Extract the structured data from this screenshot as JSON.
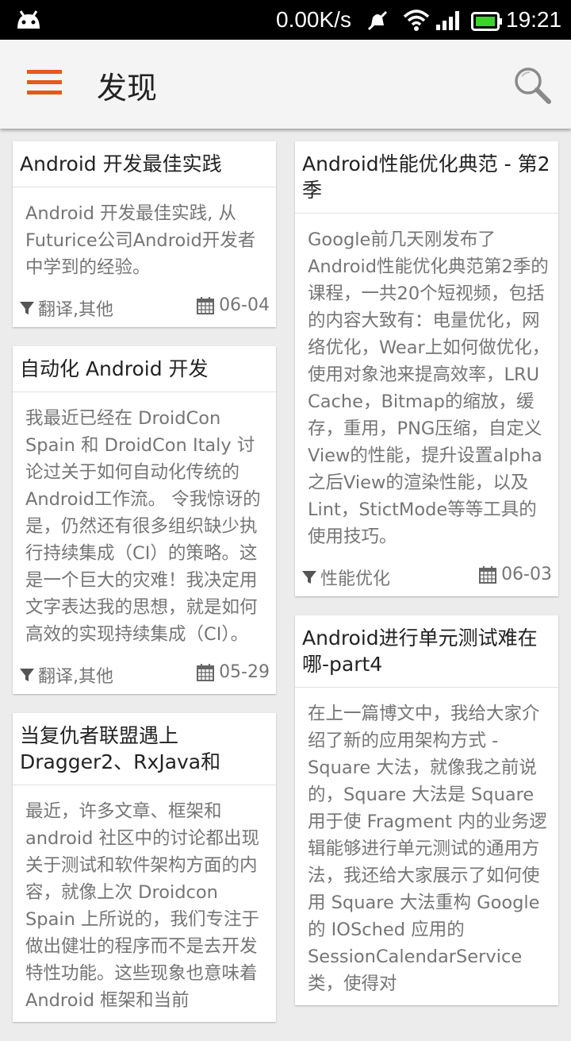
{
  "status_bar": {
    "net_speed": "0.00K/s",
    "time": "19:21"
  },
  "app_bar": {
    "title": "发现"
  },
  "colors": {
    "accent": "#e8571b",
    "card_bg": "#ffffff",
    "page_bg": "#ececec"
  },
  "cards_left": [
    {
      "title": "Android 开发最佳实践",
      "summary": "Android 开发最佳实践, 从 Futurice公司Android开发者中学到的经验。",
      "tags": "翻译,其他",
      "date": "06-04"
    },
    {
      "title": "自动化 Android 开发",
      "summary": "我最近已经在 DroidCon Spain 和 DroidCon Italy 讨论过关于如何自动化传统的Android工作流。 令我惊讶的是，仍然还有很多组织缺少执行持续集成（CI）的策略。这是一个巨大的灾难！我决定用文字表达我的思想，就是如何高效的实现持续集成（CI）。",
      "tags": "翻译,其他",
      "date": "05-29"
    },
    {
      "title": "当复仇者联盟遇上Dragger2、RxJava和",
      "summary": "最近，许多文章、框架和android 社区中的讨论都出现关于测试和软件架构方面的内容，就像上次 Droidcon Spain 上所说的，我们专注于做出健壮的程序而不是去开发特性功能。这些现象也意味着 Android 框架和当前",
      "tags": "",
      "date": ""
    }
  ],
  "cards_right": [
    {
      "title": "Android性能优化典范 - 第2季",
      "summary": "Google前几天刚发布了Android性能优化典范第2季的课程，一共20个短视频，包括的内容大致有：电量优化，网络优化，Wear上如何做优化，使用对象池来提高效率，LRU Cache，Bitmap的缩放，缓存，重用，PNG压缩，自定义View的性能，提升设置alpha之后View的渲染性能，以及Lint，StictMode等等工具的使用技巧。",
      "tags": "性能优化",
      "date": "06-03"
    },
    {
      "title": "Android进行单元测试难在哪-part4",
      "summary": "在上一篇博文中，我给大家介绍了新的应用架构方式 - Square 大法，就像我之前说的，Square 大法是 Square 用于使 Fragment 内的业务逻辑能够进行单元测试的通用方法，我还给大家展示了如何使用 Square 大法重构 Google 的 IOSched 应用的 SessionCalendarService 类，使得对",
      "tags": "",
      "date": ""
    }
  ]
}
